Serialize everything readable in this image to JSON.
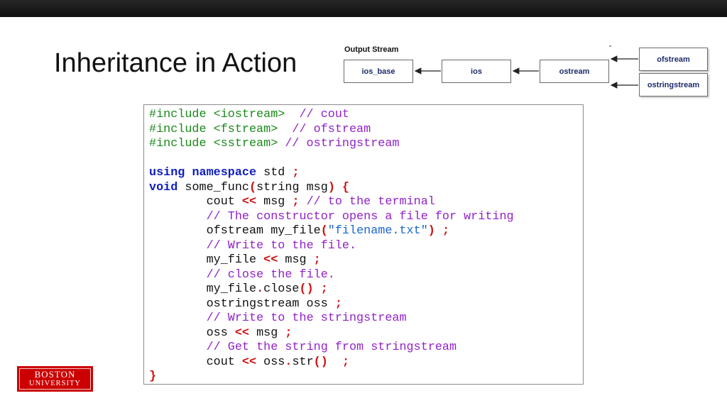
{
  "slide": {
    "title": "Inheritance in Action"
  },
  "diagram": {
    "title": "Output Stream",
    "boxes": {
      "ios_base": "ios_base",
      "ios": "ios",
      "ostream": "ostream",
      "ofstream": "ofstream",
      "ostringstream": "ostringstream"
    },
    "text_color": "#1c2c6b"
  },
  "code": {
    "lines": [
      [
        {
          "t": "inc",
          "v": "#include <iostream>  "
        },
        {
          "t": "cm",
          "v": "// cout"
        }
      ],
      [
        {
          "t": "inc",
          "v": "#include <fstream>  "
        },
        {
          "t": "cm",
          "v": "// ofstream"
        }
      ],
      [
        {
          "t": "inc",
          "v": "#include <sstream> "
        },
        {
          "t": "cm",
          "v": "// ostringstream"
        }
      ],
      [],
      [
        {
          "t": "kw",
          "v": "using"
        },
        {
          "t": "pl",
          "v": " "
        },
        {
          "t": "kw",
          "v": "namespace"
        },
        {
          "t": "pl",
          "v": " std "
        },
        {
          "t": "op",
          "v": ";"
        }
      ],
      [
        {
          "t": "kw",
          "v": "void"
        },
        {
          "t": "pl",
          "v": " some_func"
        },
        {
          "t": "op",
          "v": "("
        },
        {
          "t": "pl",
          "v": "string msg"
        },
        {
          "t": "op",
          "v": ")"
        },
        {
          "t": "pl",
          "v": " "
        },
        {
          "t": "op",
          "v": "{"
        }
      ],
      [
        {
          "t": "pl",
          "v": "        cout "
        },
        {
          "t": "op",
          "v": "<<"
        },
        {
          "t": "pl",
          "v": " msg "
        },
        {
          "t": "op",
          "v": ";"
        },
        {
          "t": "pl",
          "v": " "
        },
        {
          "t": "cm",
          "v": "// to the terminal"
        }
      ],
      [
        {
          "t": "pl",
          "v": "        "
        },
        {
          "t": "cm",
          "v": "// The constructor opens a file for writing"
        }
      ],
      [
        {
          "t": "pl",
          "v": "        ofstream my_file"
        },
        {
          "t": "op",
          "v": "("
        },
        {
          "t": "str",
          "v": "\"filename.txt\""
        },
        {
          "t": "op",
          "v": ")"
        },
        {
          "t": "pl",
          "v": " "
        },
        {
          "t": "op",
          "v": ";"
        }
      ],
      [
        {
          "t": "pl",
          "v": "        "
        },
        {
          "t": "cm",
          "v": "// Write to the file."
        }
      ],
      [
        {
          "t": "pl",
          "v": "        my_file "
        },
        {
          "t": "op",
          "v": "<<"
        },
        {
          "t": "pl",
          "v": " msg "
        },
        {
          "t": "op",
          "v": ";"
        }
      ],
      [
        {
          "t": "pl",
          "v": "        "
        },
        {
          "t": "cm",
          "v": "// close the file."
        }
      ],
      [
        {
          "t": "pl",
          "v": "        my_file"
        },
        {
          "t": "op",
          "v": "."
        },
        {
          "t": "pl",
          "v": "close"
        },
        {
          "t": "op",
          "v": "()"
        },
        {
          "t": "pl",
          "v": " "
        },
        {
          "t": "op",
          "v": ";"
        }
      ],
      [
        {
          "t": "pl",
          "v": "        ostringstream oss "
        },
        {
          "t": "op",
          "v": ";"
        }
      ],
      [
        {
          "t": "pl",
          "v": "        "
        },
        {
          "t": "cm",
          "v": "// Write to the stringstream"
        }
      ],
      [
        {
          "t": "pl",
          "v": "        oss "
        },
        {
          "t": "op",
          "v": "<<"
        },
        {
          "t": "pl",
          "v": " msg "
        },
        {
          "t": "op",
          "v": ";"
        }
      ],
      [
        {
          "t": "pl",
          "v": "        "
        },
        {
          "t": "cm",
          "v": "// Get the string from stringstream"
        }
      ],
      [
        {
          "t": "pl",
          "v": "        cout "
        },
        {
          "t": "op",
          "v": "<<"
        },
        {
          "t": "pl",
          "v": " oss"
        },
        {
          "t": "op",
          "v": "."
        },
        {
          "t": "pl",
          "v": "str"
        },
        {
          "t": "op",
          "v": "()"
        },
        {
          "t": "pl",
          "v": "  "
        },
        {
          "t": "op",
          "v": ";"
        }
      ],
      [
        {
          "t": "op",
          "v": "}"
        }
      ]
    ]
  },
  "logo": {
    "line1": "BOSTON",
    "line2": "UNIVERSITY",
    "color": "#cc0000"
  },
  "colors": {
    "include": "#1a8a1a",
    "comment": "#9222c9",
    "keyword": "#0f1fc0",
    "operator": "#d01010",
    "string": "#1a66d0"
  }
}
